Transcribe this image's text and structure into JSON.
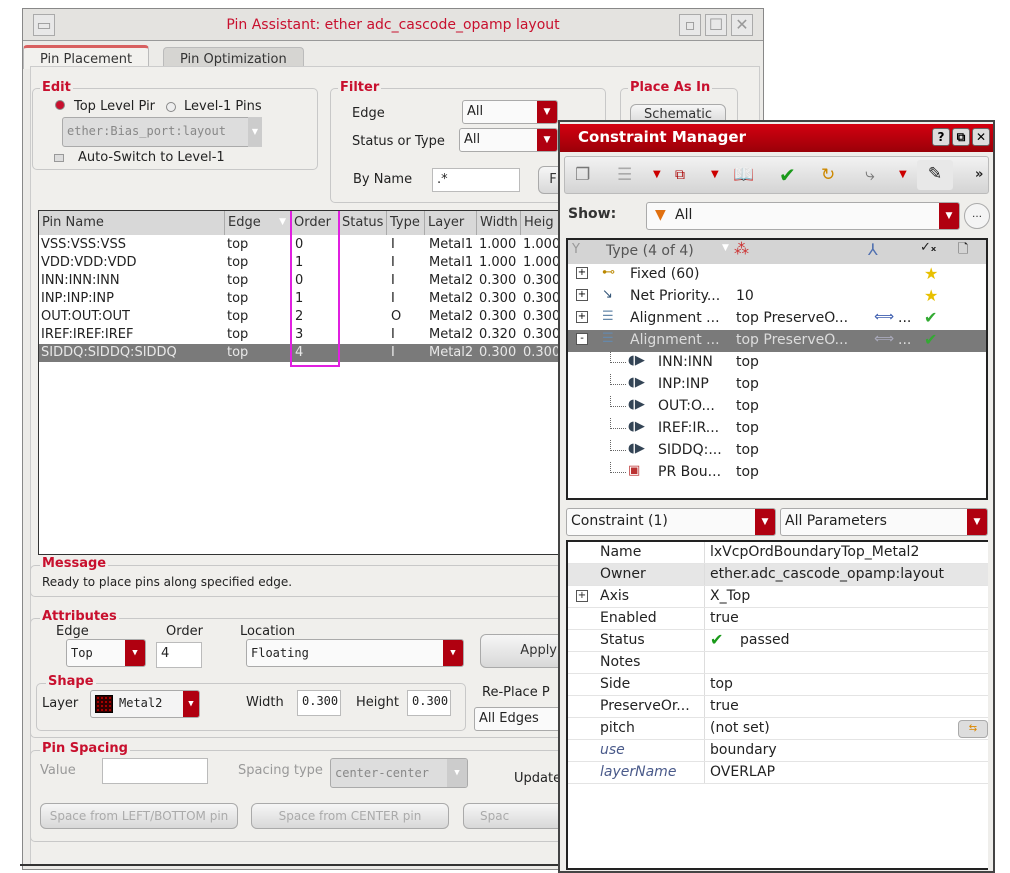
{
  "pin_assistant": {
    "title": "Pin Assistant: ether adc_cascode_opamp layout",
    "tabs": [
      {
        "label": "Pin Placement",
        "active": true
      },
      {
        "label": "Pin Optimization",
        "active": false
      }
    ],
    "edit": {
      "label": "Edit",
      "radio_top": "Top Level Pir",
      "radio_level1": "Level-1 Pins",
      "selected": "top",
      "cellview": "ether:Bias_port:layout",
      "auto_switch": "Auto-Switch to Level-1",
      "auto_switch_checked": false
    },
    "filter": {
      "label": "Filter",
      "edge_label": "Edge",
      "edge_value": "All",
      "status_label": "Status or Type",
      "status_value": "All",
      "byname_label": "By Name",
      "byname_value": ".*",
      "button_partial": "F"
    },
    "place_as_in": {
      "label": "Place As In",
      "button": "Schematic"
    },
    "table": {
      "columns": [
        "Pin Name",
        "Edge",
        "Order",
        "Status",
        "Type",
        "Layer",
        "Width",
        "Heig"
      ],
      "rows": [
        {
          "name": "VSS:VSS:VSS",
          "edge": "top",
          "order": "0",
          "status": "",
          "type": "I",
          "layer": "Metal1",
          "width": "1.000",
          "height": "1.000"
        },
        {
          "name": "VDD:VDD:VDD",
          "edge": "top",
          "order": "1",
          "status": "",
          "type": "I",
          "layer": "Metal1",
          "width": "1.000",
          "height": "1.000"
        },
        {
          "name": "INN:INN:INN",
          "edge": "top",
          "order": "0",
          "status": "",
          "type": "I",
          "layer": "Metal2",
          "width": "0.300",
          "height": "0.300"
        },
        {
          "name": "INP:INP:INP",
          "edge": "top",
          "order": "1",
          "status": "",
          "type": "I",
          "layer": "Metal2",
          "width": "0.300",
          "height": "0.300"
        },
        {
          "name": "OUT:OUT:OUT",
          "edge": "top",
          "order": "2",
          "status": "",
          "type": "O",
          "layer": "Metal2",
          "width": "0.300",
          "height": "0.300"
        },
        {
          "name": "IREF:IREF:IREF",
          "edge": "top",
          "order": "3",
          "status": "",
          "type": "I",
          "layer": "Metal2",
          "width": "0.320",
          "height": "0.300"
        },
        {
          "name": "SIDDQ:SIDDQ:SIDDQ",
          "edge": "top",
          "order": "4",
          "status": "",
          "type": "I",
          "layer": "Metal2",
          "width": "0.300",
          "height": "0.300",
          "selected": true
        }
      ],
      "highlight_color": "#e020e0"
    },
    "message": {
      "label": "Message",
      "text": "Ready to place pins along specified edge."
    },
    "attributes": {
      "label": "Attributes",
      "edge_label": "Edge",
      "edge_value": "Top",
      "order_label": "Order",
      "order_value": "4",
      "location_label": "Location",
      "location_value": "Floating",
      "apply": "Apply",
      "shape": {
        "label": "Shape",
        "layer_label": "Layer",
        "layer_value": "Metal2",
        "layer_purpose": "d",
        "width_label": "Width",
        "width_value": "0.300",
        "height_label": "Height",
        "height_value": "0.300"
      },
      "replace_label": "Re-Place P",
      "replace_value": "All Edges"
    },
    "pin_spacing": {
      "label": "Pin Spacing",
      "value_label": "Value",
      "value": "",
      "type_label": "Spacing type",
      "type_value": "center-center",
      "update_label": "Update",
      "btn_left": "Space from LEFT/BOTTOM pin",
      "btn_center": "Space from CENTER pin",
      "btn_right": "Spac"
    }
  },
  "constraint_manager": {
    "title": "Constraint Manager",
    "title_color": "#c00010",
    "toolbar": [
      "copy-icon",
      "align-icon",
      "dropdown",
      "group-icon",
      "dropdown",
      "book-icon",
      "check-icon",
      "refresh-icon",
      "hierarchy-icon",
      "dropdown",
      "edit-icon",
      "more-icon"
    ],
    "show_label": "Show:",
    "show_value": "All",
    "tree_header": {
      "type": "Type (4 of 4)"
    },
    "tree": [
      {
        "label": "Fixed (60)",
        "value": "",
        "expander": "+",
        "icon": "fixed-icon",
        "status": "star"
      },
      {
        "label": "Net Priority...",
        "value": "10",
        "expander": "+",
        "icon": "net-priority-icon",
        "status": "star"
      },
      {
        "label": "Alignment ...",
        "value": "top PreserveO...",
        "extra": "...",
        "expander": "+",
        "icon": "alignment-icon",
        "status": "check-star"
      },
      {
        "label": "Alignment ...",
        "value": "top PreserveO...",
        "extra": "...",
        "expander": "-",
        "icon": "alignment-icon",
        "status": "check-star",
        "selected": true
      },
      {
        "label": "INN:INN",
        "value": "top",
        "child": true,
        "icon": "pin-icon"
      },
      {
        "label": "INP:INP",
        "value": "top",
        "child": true,
        "icon": "pin-icon"
      },
      {
        "label": "OUT:O...",
        "value": "top",
        "child": true,
        "icon": "pin-icon"
      },
      {
        "label": "IREF:IR...",
        "value": "top",
        "child": true,
        "icon": "pin-icon"
      },
      {
        "label": "SIDDQ:...",
        "value": "top",
        "child": true,
        "icon": "pin-icon"
      },
      {
        "label": "PR Bou...",
        "value": "top",
        "child": true,
        "icon": "boundary-icon"
      }
    ],
    "constraint_select": "Constraint (1)",
    "params_select": "All Parameters",
    "properties": [
      {
        "key": "Name",
        "value": "lxVcpOrdBoundaryTop_Metal2"
      },
      {
        "key": "Owner",
        "value": "ether.adc_cascode_opamp:layout",
        "alt": true
      },
      {
        "key": "Axis",
        "value": "X_Top",
        "expander": "+"
      },
      {
        "key": "Enabled",
        "value": "true"
      },
      {
        "key": "Status",
        "value": "passed",
        "check": true
      },
      {
        "key": "Notes",
        "value": ""
      },
      {
        "key": "Side",
        "value": "top"
      },
      {
        "key": "PreserveOr...",
        "value": "true"
      },
      {
        "key": "pitch",
        "value": "(not set)",
        "button": true
      },
      {
        "key": "use",
        "value": "boundary",
        "italic": true
      },
      {
        "key": "layerName",
        "value": "OVERLAP",
        "italic": true
      }
    ]
  }
}
